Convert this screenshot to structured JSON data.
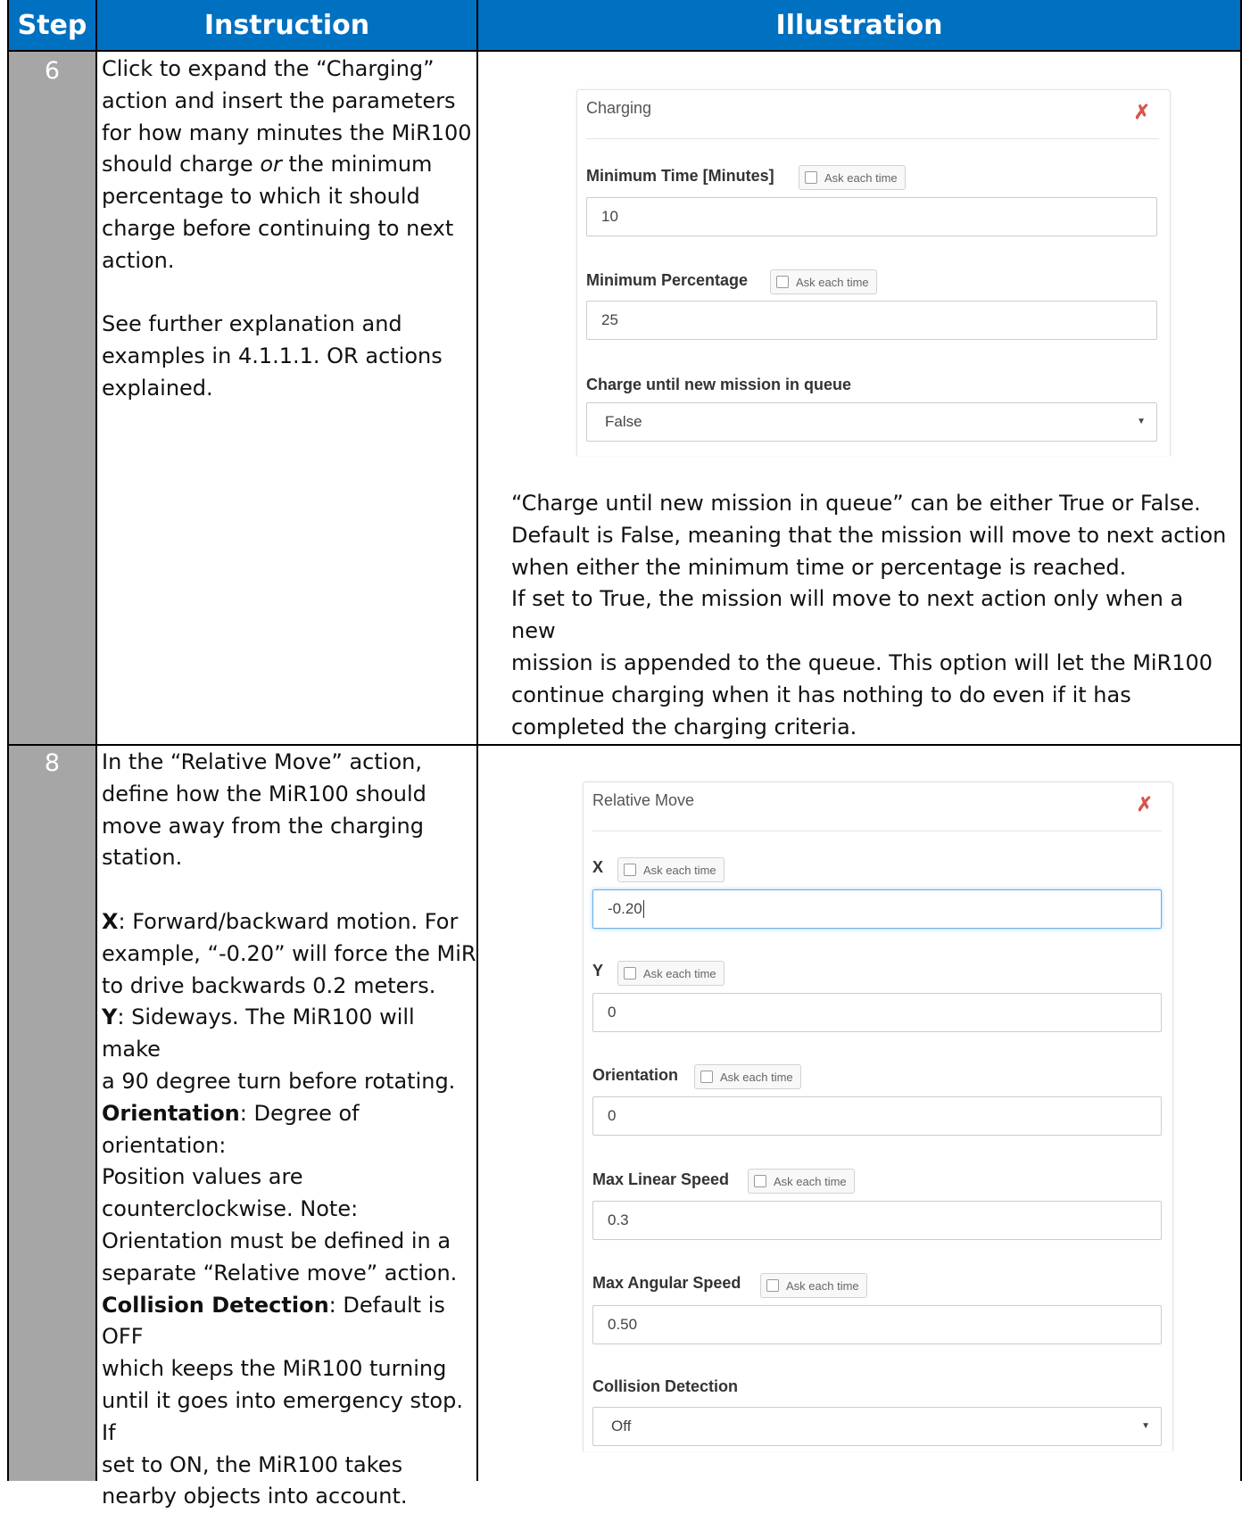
{
  "header": {
    "step": "Step",
    "instruction": "Instruction",
    "illustration": "Illustration"
  },
  "rows": [
    {
      "step": "6",
      "instruction": {
        "p1a": "Click to expand the “Charging”",
        "p1b": "action and insert the parameters",
        "p1c": "for how many minutes the MiR100",
        "p1d_pre": "should charge ",
        "p1d_em": "or",
        "p1d_post": " the minimum",
        "p1e": "percentage to which it should",
        "p1f": "charge before continuing to next",
        "p1g": "action.",
        "p2a": "See further explanation and",
        "p2b": "examples in 4.1.1.1. OR actions",
        "p2c": "explained."
      },
      "panel": {
        "title": "Charging",
        "close": "✗",
        "fields": [
          {
            "label": "Minimum Time [Minutes]",
            "ask": "Ask each time",
            "value": "10"
          },
          {
            "label": "Minimum Percentage",
            "ask": "Ask each time",
            "value": "25"
          }
        ],
        "select": {
          "label": "Charge until new mission in queue",
          "value": "False",
          "arrow": "▼"
        }
      },
      "description": [
        "“Charge until new mission in queue” can be either True or False.",
        "Default is False, meaning that the mission will move to next action",
        "when either the minimum time or percentage is reached.",
        "If set to True, the mission will move to next action only when a new",
        "mission is appended to the queue. This option will let the MiR100",
        "continue charging when it has nothing to do even if it has",
        "completed the charging criteria."
      ]
    },
    {
      "step": "8",
      "instruction": {
        "l1": "In the “Relative Move” action,",
        "l2": "define how the MiR100 should",
        "l3": "move away from the charging",
        "l4": "station.",
        "x_key": "X",
        "x_text1": ": Forward/backward motion. For",
        "x_text2": "example, “-0.20” will force the MiR",
        "x_text3": "to drive backwards 0.2 meters.",
        "y_key": "Y",
        "y_text1": ": Sideways. The MiR100 will make",
        "y_text2": "a 90 degree turn before rotating.",
        "o_key": "Orientation",
        "o_text1": ": Degree of orientation:",
        "o_text2": "Position values are",
        "o_text3": "counterclockwise.  Note:",
        "o_text4": "Orientation must be defined in a",
        "o_text5": "separate “Relative move” action.",
        "c_key": "Collision Detection",
        "c_text1": ": Default is OFF",
        "c_text2": "which keeps the MiR100 turning",
        "c_text3": "until it goes into emergency stop. If",
        "c_text4": "set to ON, the MiR100 takes",
        "c_text5": "nearby objects into account."
      },
      "panel": {
        "title": "Relative Move",
        "close": "✗",
        "fields": [
          {
            "label": "X",
            "ask": "Ask each time",
            "value": "-0.20"
          },
          {
            "label": "Y",
            "ask": "Ask each time",
            "value": "0"
          },
          {
            "label": "Orientation",
            "ask": "Ask each time",
            "value": "0"
          },
          {
            "label": "Max Linear Speed",
            "ask": "Ask each time",
            "value": "0.3"
          },
          {
            "label": "Max Angular Speed",
            "ask": "Ask each time",
            "value": "0.50"
          }
        ],
        "select": {
          "label": "Collision Detection",
          "value": "Off",
          "arrow": "▼"
        }
      }
    }
  ],
  "colors": {
    "header_bg": "#0070c0",
    "step_bg": "#a6a6a6",
    "close_red": "#d9534f",
    "focus_blue": "#66afe9"
  }
}
